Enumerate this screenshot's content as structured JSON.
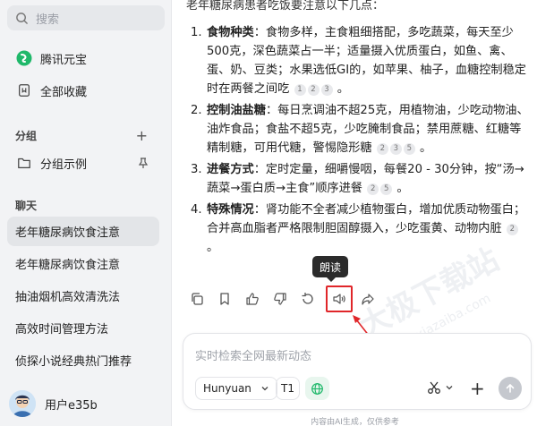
{
  "sidebar": {
    "search_placeholder": "搜索",
    "nav": [
      {
        "label": "腾讯元宝"
      },
      {
        "label": "全部收藏"
      }
    ],
    "group_title": "分组",
    "group_item": "分组示例",
    "chat_title": "聊天",
    "chats": [
      {
        "label": "老年糖尿病饮食注意"
      },
      {
        "label": "老年糖尿病饮食注意"
      },
      {
        "label": "抽油烟机高效清洗法"
      },
      {
        "label": "高效时间管理方法"
      },
      {
        "label": "侦探小说经典热门推荐"
      }
    ],
    "username": "用户e35b"
  },
  "content": {
    "topline": "老年糖尿病患者吃饭要注意以下几点：",
    "items": [
      {
        "num": "1.",
        "title": "食物种类",
        "text": "：食物多样，主食粗细搭配，多吃蔬菜，每天至少500克，深色蔬菜占一半；适量摄入优质蛋白，如鱼、禽、蛋、奶、豆类；水果选低GI的，如苹果、柚子，血糖控制稳定时在两餐之间吃",
        "cites": [
          "1",
          "2",
          "3"
        ]
      },
      {
        "num": "2.",
        "title": "控制油盐糖",
        "text": "：每日烹调油不超25克，用植物油，少吃动物油、油炸食品；食盐不超5克，少吃腌制食品；禁用蔗糖、红糖等精制糖，可用代糖，警惕隐形糖",
        "cites": [
          "2",
          "3",
          "5"
        ]
      },
      {
        "num": "3.",
        "title": "进餐方式",
        "text": "：定时定量，细嚼慢咽，每餐20 - 30分钟，按“汤→蔬菜→蛋白质→主食”顺序进餐",
        "cites": [
          "2",
          "5"
        ]
      },
      {
        "num": "4.",
        "title": "特殊情况",
        "text": "：肾功能不全者减少植物蛋白，增加优质动物蛋白；合并高血脂者严格限制胆固醇摄入，少吃蛋黄、动物内脏",
        "cites": [
          "2"
        ]
      }
    ],
    "period": "。"
  },
  "tooltip": "朗读",
  "input": {
    "placeholder": "实时检索全网最新动态",
    "model": "Hunyuan",
    "t1": "T1"
  },
  "footer": "内容由AI生成，仅供参考",
  "watermark": "大极下载站",
  "watermark_url": "www.xiazaiba.com",
  "colors": {
    "accent_red": "#e0262a",
    "brand_green": "#1fb86a"
  }
}
